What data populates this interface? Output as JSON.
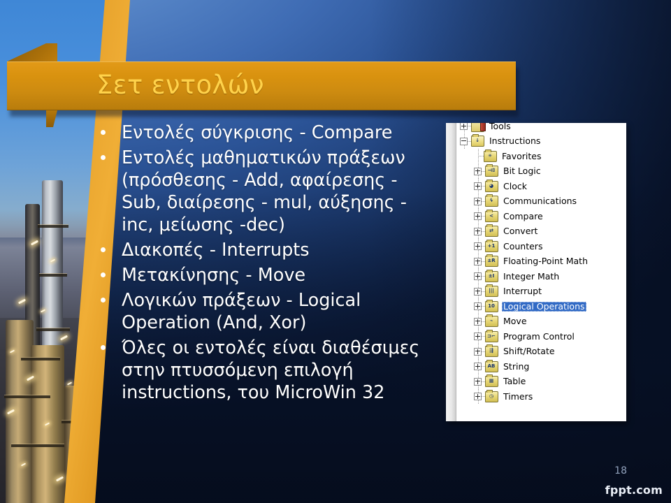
{
  "slide": {
    "title": "Σετ εντολών",
    "page_number": "18",
    "watermark": "fppt.com",
    "colors": {
      "ribbon_orange": "#d9920f",
      "title_yellow": "#ffd24a",
      "background_blue": "#3f6cb4",
      "background_navy": "#0a1730",
      "selection_blue": "#316ac5"
    }
  },
  "bullets": [
    {
      "text": "Εντολές σύγκρισης - Compare"
    },
    {
      "text": "Εντολές μαθηματικών πράξεων (πρόσθεσης -  Add, αφαίρεσης -Sub, διαίρεσης - mul, αύξησης - inc, μείωσης -dec)"
    },
    {
      "text": "Διακοπές - Interrupts"
    },
    {
      "text": "Μετακίνησης - Move"
    },
    {
      "text": "Λογικών πράξεων - Logical Operation (And, Xor)"
    },
    {
      "text": "Όλες οι εντολές είναι διαθέσιμες στην πτυσσόμενη επιλογή instructions, του MicroWin 32"
    }
  ],
  "tree": {
    "nodes": [
      {
        "label": "Tools",
        "level": 0,
        "toggle": "plus",
        "icon": "tools-folder-icon",
        "glyph": "",
        "selected": false
      },
      {
        "label": "Instructions",
        "level": 0,
        "toggle": "minus",
        "icon": "instructions-folder-icon",
        "glyph": "↓",
        "selected": false
      },
      {
        "label": "Favorites",
        "level": 1,
        "toggle": "none",
        "icon": "favorites-folder-icon",
        "glyph": "✳",
        "selected": false
      },
      {
        "label": "Bit Logic",
        "level": 1,
        "toggle": "plus",
        "icon": "bit-logic-folder-icon",
        "glyph": "⊣⌷",
        "selected": false
      },
      {
        "label": "Clock",
        "level": 1,
        "toggle": "plus",
        "icon": "clock-folder-icon",
        "glyph": "◕",
        "selected": false
      },
      {
        "label": "Communications",
        "level": 1,
        "toggle": "plus",
        "icon": "communications-folder-icon",
        "glyph": "ϟ",
        "selected": false
      },
      {
        "label": "Compare",
        "level": 1,
        "toggle": "plus",
        "icon": "compare-folder-icon",
        "glyph": "<",
        "selected": false
      },
      {
        "label": "Convert",
        "level": 1,
        "toggle": "plus",
        "icon": "convert-folder-icon",
        "glyph": "⇄",
        "selected": false
      },
      {
        "label": "Counters",
        "level": 1,
        "toggle": "plus",
        "icon": "counters-folder-icon",
        "glyph": "+1",
        "selected": false
      },
      {
        "label": "Floating-Point Math",
        "level": 1,
        "toggle": "plus",
        "icon": "floating-point-folder-icon",
        "glyph": "±R",
        "selected": false
      },
      {
        "label": "Integer Math",
        "level": 1,
        "toggle": "plus",
        "icon": "integer-math-folder-icon",
        "glyph": "±I",
        "selected": false
      },
      {
        "label": "Interrupt",
        "level": 1,
        "toggle": "plus",
        "icon": "interrupt-folder-icon",
        "glyph": "|||",
        "selected": false
      },
      {
        "label": "Logical Operations",
        "level": 1,
        "toggle": "plus",
        "icon": "logical-operations-folder-icon",
        "glyph": "10",
        "selected": true
      },
      {
        "label": "Move",
        "level": 1,
        "toggle": "plus",
        "icon": "move-folder-icon",
        "glyph": "⌁",
        "selected": false
      },
      {
        "label": "Program Control",
        "level": 1,
        "toggle": "plus",
        "icon": "program-control-folder-icon",
        "glyph": "⊐⌐",
        "selected": false
      },
      {
        "label": "Shift/Rotate",
        "level": 1,
        "toggle": "plus",
        "icon": "shift-rotate-folder-icon",
        "glyph": "⇶",
        "selected": false
      },
      {
        "label": "String",
        "level": 1,
        "toggle": "plus",
        "icon": "string-folder-icon",
        "glyph": "AB",
        "selected": false
      },
      {
        "label": "Table",
        "level": 1,
        "toggle": "plus",
        "icon": "table-folder-icon",
        "glyph": "▦",
        "selected": false
      },
      {
        "label": "Timers",
        "level": 1,
        "toggle": "plus",
        "icon": "timers-folder-icon",
        "glyph": "◷",
        "selected": false
      }
    ]
  }
}
